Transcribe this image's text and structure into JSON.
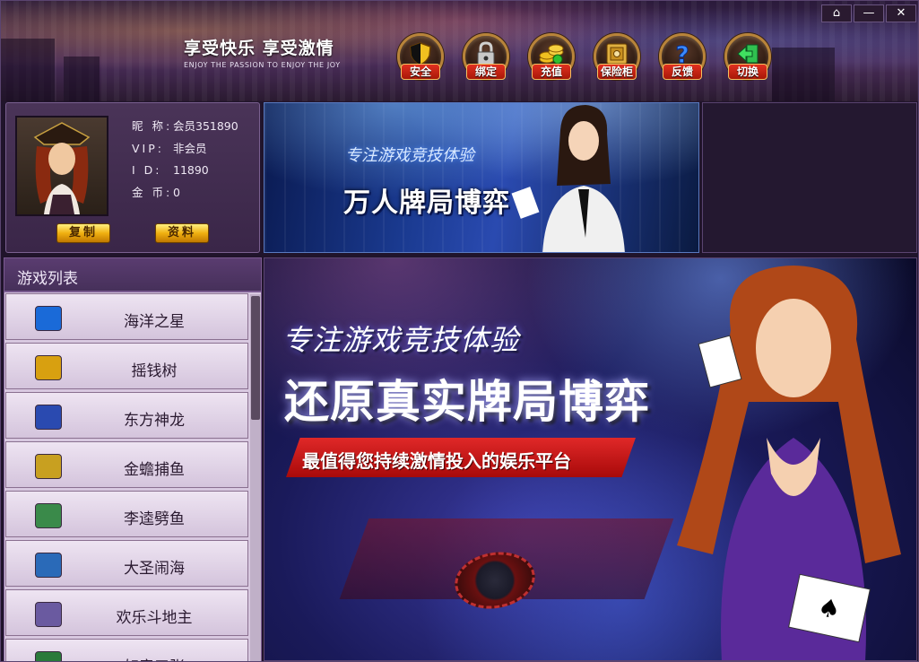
{
  "header": {
    "slogan_cn": "享受快乐  享受激情",
    "slogan_en": "ENJOY THE PASSION TO ENJOY THE JOY",
    "toolbar": [
      {
        "label": "安全",
        "icon": "shield-icon"
      },
      {
        "label": "绑定",
        "icon": "lock-icon"
      },
      {
        "label": "充值",
        "icon": "coins-icon"
      },
      {
        "label": "保险柜",
        "icon": "safe-icon"
      },
      {
        "label": "反馈",
        "icon": "question-icon"
      },
      {
        "label": "切换",
        "icon": "switch-arrow-icon"
      }
    ],
    "window_controls": {
      "home": "⌂",
      "minimize": "—",
      "close": "✕"
    }
  },
  "profile": {
    "fields": [
      {
        "key": "昵  称:",
        "value": "会员351890"
      },
      {
        "key": "VIP:",
        "value": "非会员"
      },
      {
        "key": "I  D:",
        "value": "11890"
      },
      {
        "key": "金  币:",
        "value": "0"
      }
    ],
    "copy_button": "复制",
    "info_button": "资料"
  },
  "banner_small": {
    "line1": "专注游戏竞技体验",
    "line2": "万人牌局博弈"
  },
  "game_list": {
    "title": "游戏列表",
    "items": [
      {
        "name": "海洋之星",
        "icon_color": "#1a6ad8"
      },
      {
        "name": "摇钱树",
        "icon_color": "#d8a010"
      },
      {
        "name": "东方神龙",
        "icon_color": "#2a4ab0"
      },
      {
        "name": "金蟾捕鱼",
        "icon_color": "#c8a020"
      },
      {
        "name": "李逵劈鱼",
        "icon_color": "#3a8a4a"
      },
      {
        "name": "大圣闹海",
        "icon_color": "#2a6ab8"
      },
      {
        "name": "欢乐斗地主",
        "icon_color": "#6a5aa0"
      },
      {
        "name": "如意三张",
        "icon_color": "#2a7a3a"
      }
    ]
  },
  "banner_main": {
    "line1": "专注游戏竞技体验",
    "line2": "还原真实牌局博弈",
    "ribbon": "最值得您持续激情投入的娱乐平台"
  }
}
